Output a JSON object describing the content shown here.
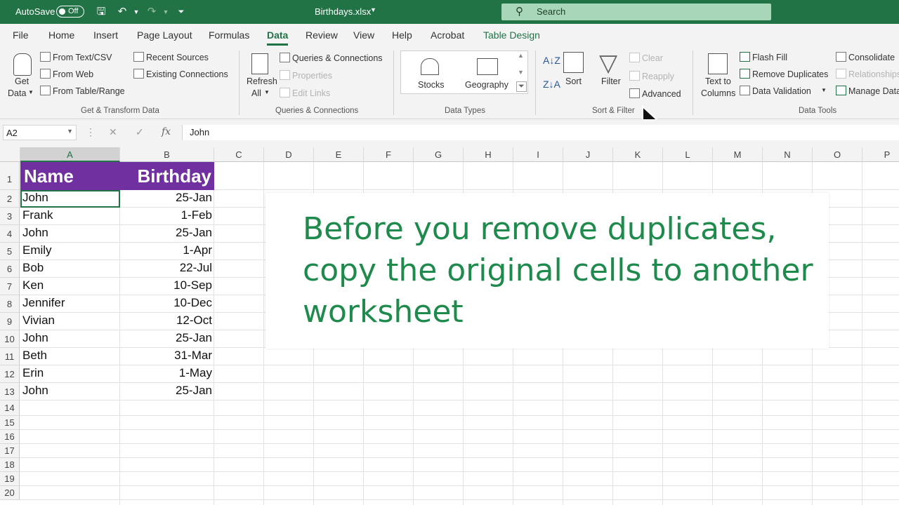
{
  "titlebar": {
    "autosave_label": "AutoSave",
    "autosave_state": "Off",
    "filename": "Birthdays.xlsx",
    "search_placeholder": "Search",
    "accent_color": "#217346"
  },
  "tabs": [
    "File",
    "Home",
    "Insert",
    "Page Layout",
    "Formulas",
    "Data",
    "Review",
    "View",
    "Help",
    "Acrobat",
    "Table Design"
  ],
  "active_tab": "Data",
  "ribbon": {
    "get_transform": {
      "get_data": [
        "Get",
        "Data"
      ],
      "from_text_csv": "From Text/CSV",
      "from_web": "From Web",
      "from_table_range": "From Table/Range",
      "recent_sources": "Recent Sources",
      "existing_connections": "Existing Connections",
      "label": "Get & Transform Data"
    },
    "queries": {
      "refresh": [
        "Refresh",
        "All"
      ],
      "queries_connections": "Queries & Connections",
      "properties": "Properties",
      "edit_links": "Edit Links",
      "label": "Queries & Connections"
    },
    "data_types": {
      "stocks": "Stocks",
      "geography": "Geography",
      "label": "Data Types"
    },
    "sort_filter": {
      "sort": "Sort",
      "filter": "Filter",
      "clear": "Clear",
      "reapply": "Reapply",
      "advanced": "Advanced",
      "label": "Sort & Filter"
    },
    "data_tools": {
      "text_to_columns": [
        "Text to",
        "Columns"
      ],
      "flash_fill": "Flash Fill",
      "remove_duplicates": "Remove Duplicates",
      "data_validation": "Data Validation",
      "consolidate": "Consolidate",
      "relationships": "Relationships",
      "manage_data_model": "Manage Data Model",
      "label": "Data Tools"
    }
  },
  "formula_bar": {
    "name_box": "A2",
    "value": "John"
  },
  "sheet": {
    "columns": [
      "A",
      "B",
      "C",
      "D",
      "E",
      "F",
      "G",
      "H",
      "I",
      "J",
      "K",
      "L",
      "M",
      "N",
      "O",
      "P"
    ],
    "selected_column": "A",
    "header": [
      "Name",
      "Birthday"
    ],
    "header_color": "#7030a0",
    "rows": [
      [
        "John",
        "25-Jan"
      ],
      [
        "Frank",
        "1-Feb"
      ],
      [
        "John",
        "25-Jan"
      ],
      [
        "Emily",
        "1-Apr"
      ],
      [
        "Bob",
        "22-Jul"
      ],
      [
        "Ken",
        "10-Sep"
      ],
      [
        "Jennifer",
        "10-Dec"
      ],
      [
        "Vivian",
        "12-Oct"
      ],
      [
        "John",
        "25-Jan"
      ],
      [
        "Beth",
        "31-Mar"
      ],
      [
        "Erin",
        "1-May"
      ],
      [
        "John",
        "25-Jan"
      ]
    ],
    "row_numbers": [
      "1",
      "2",
      "3",
      "4",
      "5",
      "6",
      "7",
      "8",
      "9",
      "10",
      "11",
      "12",
      "13",
      "14",
      "15",
      "16",
      "17",
      "18",
      "19",
      "20"
    ]
  },
  "callout": {
    "text": "Before you remove duplicates, copy the original cells to another worksheet",
    "color": "#1e8a4c"
  }
}
